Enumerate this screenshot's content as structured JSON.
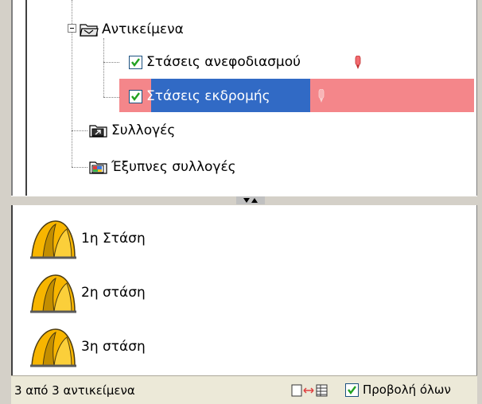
{
  "tree": {
    "objects": {
      "label": "Αντικείμενα"
    },
    "items": [
      {
        "label": "Στάσεις ανεφοδιασμού",
        "checked": true
      },
      {
        "label": "Στάσεις εκδρομής",
        "checked": true,
        "selected": true
      }
    ],
    "collections": {
      "label": "Συλλογές"
    },
    "smart_collections": {
      "label": "Έξυπνες συλλογές"
    }
  },
  "list": {
    "items": [
      {
        "label": "1η Στάση"
      },
      {
        "label": "2η στάση"
      },
      {
        "label": "3η στάση"
      }
    ]
  },
  "status": {
    "count": "3 από 3 αντικείμενα",
    "show_all": "Προβολή όλων",
    "show_all_checked": true
  },
  "colors": {
    "selection_blue": "#316ac5",
    "selection_pink": "#f4868a",
    "tent_yellow": "#f7b500",
    "check_green": "#21a121"
  }
}
